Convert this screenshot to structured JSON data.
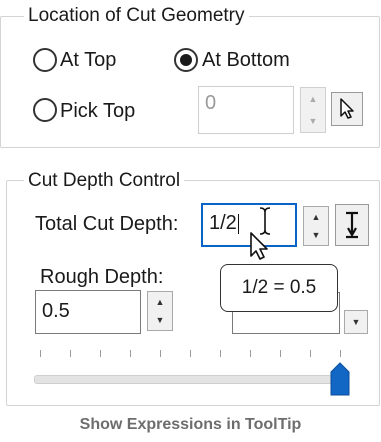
{
  "location_group": {
    "title": "Location of Cut Geometry",
    "options": [
      {
        "label": "At Top",
        "selected": false
      },
      {
        "label": "At Bottom",
        "selected": true
      },
      {
        "label": "Pick Top",
        "selected": false
      }
    ],
    "pick_top_value": "0"
  },
  "cut_depth_group": {
    "title": "Cut Depth Control",
    "total_cut_depth_label": "Total Cut Depth:",
    "total_cut_depth_value": "1/2",
    "rough_depth_label": "Rough Depth:",
    "rough_depth_value": "0.5",
    "slider_level": 1.0
  },
  "tooltip": {
    "text": "1/2 = 0.5"
  },
  "caption": "Show Expressions in ToolTip",
  "colors": {
    "accent": "#0a64c8",
    "slider_thumb": "#1266c4",
    "caption": "#6d6d6d"
  },
  "icons": {
    "spin_up": "triangle-up",
    "spin_down": "triangle-down",
    "pick": "cursor-arrow",
    "measure": "text-cursor-depth"
  }
}
